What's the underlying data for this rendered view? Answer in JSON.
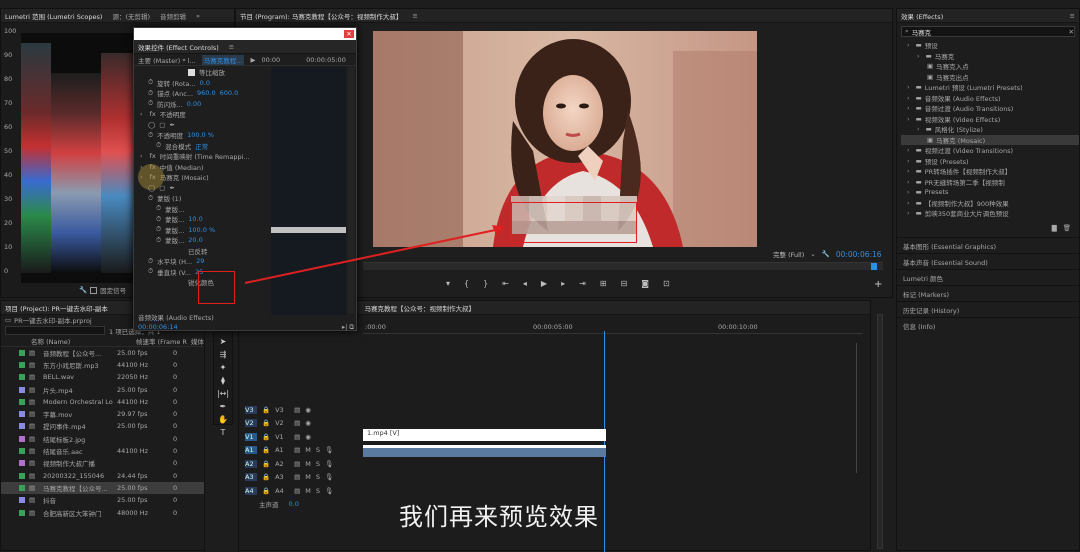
{
  "scopes": {
    "tab_scopes": "Lumetri 范围 (Lumetri Scopes)",
    "tab_source": "源：(无剪辑)",
    "tab_audio": "音频剪辑",
    "ticks": [
      "100",
      "90",
      "80",
      "70",
      "60",
      "50",
      "40",
      "30",
      "20",
      "10",
      "0"
    ],
    "checkbox_label": "固定信号"
  },
  "effect_controls": {
    "title": "效果控件 (Effect Controls)",
    "master": "主要 (Master) * l...",
    "clip": "马赛克教程...",
    "timecode_start": "00:00",
    "timecode_mid": "00:00:05:00",
    "rows": [
      {
        "label": "等比缩放",
        "value": "",
        "v2": "",
        "ind": 54,
        "check": true
      },
      {
        "label": "旋转 (Rota...",
        "value": "0.0",
        "v2": "",
        "ind": 14
      },
      {
        "label": "锚点 (Anc...",
        "value": "960.0",
        "v2": "600.0",
        "ind": 14
      },
      {
        "label": "防闪烁...",
        "value": "0.00",
        "v2": "",
        "ind": 14
      },
      {
        "label": "不透明度",
        "value": "",
        "v2": "",
        "ind": 6,
        "fx": true
      },
      {
        "label": "",
        "value": "",
        "v2": "",
        "ind": 14,
        "shapes": true
      },
      {
        "label": "不透明度",
        "value": "100.0 %",
        "v2": "",
        "ind": 14
      },
      {
        "label": "混合模式",
        "value": "正常",
        "v2": "",
        "ind": 22
      },
      {
        "label": "时间重映射 (Time Remappi...",
        "value": "",
        "v2": "",
        "ind": 6,
        "fx": true
      },
      {
        "label": "中值 (Median)",
        "value": "",
        "v2": "",
        "ind": 6,
        "fx": true
      },
      {
        "label": "马赛克 (Mosaic)",
        "value": "",
        "v2": "",
        "ind": 6,
        "fx": true
      },
      {
        "label": "",
        "value": "",
        "v2": "",
        "ind": 14,
        "shapes": true
      },
      {
        "label": "蒙版 (1)",
        "value": "",
        "v2": "",
        "ind": 14
      },
      {
        "label": "蒙版...",
        "value": "",
        "v2": "",
        "ind": 22
      },
      {
        "label": "蒙版...",
        "value": "10.0",
        "v2": "",
        "ind": 22
      },
      {
        "label": "蒙版...",
        "value": "100.0 %",
        "v2": "",
        "ind": 22
      },
      {
        "label": "蒙版...",
        "value": "20.0",
        "v2": "",
        "ind": 22
      },
      {
        "label": "已反转",
        "value": "",
        "v2": "",
        "ind": 54
      },
      {
        "label": "水平块 (H...",
        "value": "29",
        "v2": "",
        "ind": 14
      },
      {
        "label": "垂直块 (V...",
        "value": "25",
        "v2": "",
        "ind": 14
      },
      {
        "label": "锐化颜色",
        "value": "",
        "v2": "",
        "ind": 54
      }
    ],
    "audio_label": "音频效果 (Audio Effects)",
    "timecode": "00:00:06:14"
  },
  "program": {
    "tab": "节目 (Program): 马赛克教程【公众号：视频制作大叔】",
    "fit": "完整 (Full)",
    "timecode": "00:00:06:16"
  },
  "effects": {
    "title": "效果 (Effects)",
    "search": "马赛克",
    "items": [
      {
        "label": "预设",
        "ind": 6,
        "type": "folder"
      },
      {
        "label": "马赛克",
        "ind": 16,
        "type": "folder"
      },
      {
        "label": "马赛克入点",
        "ind": 26,
        "type": "file"
      },
      {
        "label": "马赛克出点",
        "ind": 26,
        "type": "file"
      },
      {
        "label": "Lumetri 预设 (Lumetri Presets)",
        "ind": 6,
        "type": "folder"
      },
      {
        "label": "音频效果 (Audio Effects)",
        "ind": 6,
        "type": "folder"
      },
      {
        "label": "音频过渡 (Audio Transitions)",
        "ind": 6,
        "type": "folder"
      },
      {
        "label": "视频效果 (Video Effects)",
        "ind": 6,
        "type": "folder"
      },
      {
        "label": "风格化 (Stylize)",
        "ind": 16,
        "type": "folder"
      },
      {
        "label": "马赛克 (Mosaic)",
        "ind": 26,
        "type": "file",
        "sel": true
      },
      {
        "label": "视频过渡 (Video Transitions)",
        "ind": 6,
        "type": "folder"
      },
      {
        "label": "预设 (Presets)",
        "ind": 6,
        "type": "folder"
      },
      {
        "label": "PR转场插件【视频制作大叔】",
        "ind": 6,
        "type": "folder"
      },
      {
        "label": "PR无缝转场第二季【视频制",
        "ind": 6,
        "type": "folder"
      },
      {
        "label": "Presets",
        "ind": 6,
        "type": "folder"
      },
      {
        "label": "【视频制作大叔】900种效果",
        "ind": 6,
        "type": "folder"
      },
      {
        "label": "剪映350套商业大片调色预设",
        "ind": 6,
        "type": "folder"
      }
    ],
    "sections": [
      "基本图形 (Essential Graphics)",
      "基本声音 (Essential Sound)",
      "Lumetri 颜色",
      "标记 (Markers)",
      "历史记录 (History)",
      "信息 (Info)"
    ]
  },
  "project": {
    "title": "项目 (Project): PR一键去水印-副本",
    "file": "PR一键去水印-副本.prproj",
    "items_selected": "1 项已选择，共 1",
    "col_name": "名称 (Name)",
    "col_fps": "帧速率 (Frame R",
    "col_media": "媒体",
    "rows": [
      {
        "name": "音频教程【公众号...",
        "fps": "25.00 fps",
        "m": "0",
        "color": "#3aa05a",
        "icon": "seq"
      },
      {
        "name": "东方小戏尼斯.mp3",
        "fps": "44100 Hz",
        "m": "0",
        "color": "#3aa05a",
        "icon": "aud"
      },
      {
        "name": "BELL.wav",
        "fps": "22050 Hz",
        "m": "0",
        "color": "#3aa05a",
        "icon": "aud"
      },
      {
        "name": "片头.mp4",
        "fps": "25.00 fps",
        "m": "0",
        "color": "#8a8ae0",
        "icon": "vid"
      },
      {
        "name": "Modern Orchestral Log",
        "fps": "44100 Hz",
        "m": "0",
        "color": "#3aa05a",
        "icon": "aud"
      },
      {
        "name": "字幕.mov",
        "fps": "29.97 fps",
        "m": "0",
        "color": "#8a8ae0",
        "icon": "vid"
      },
      {
        "name": "提问事件.mp4",
        "fps": "25.00 fps",
        "m": "0",
        "color": "#8a8ae0",
        "icon": "vid"
      },
      {
        "name": "结尾标板2.jpg",
        "fps": "",
        "m": "0",
        "color": "#b070d0",
        "icon": "img"
      },
      {
        "name": "结尾音乐.aac",
        "fps": "44100 Hz",
        "m": "0",
        "color": "#3aa05a",
        "icon": "aud"
      },
      {
        "name": "视频制作大叔广播",
        "fps": "",
        "m": "0",
        "color": "#b070d0",
        "icon": "img"
      },
      {
        "name": "20200322_155046",
        "fps": "24.44 fps",
        "m": "0",
        "color": "#3aa05a",
        "icon": "seq"
      },
      {
        "name": "马赛克教程【公众号...",
        "fps": "25.00 fps",
        "m": "0",
        "color": "#3aa05a",
        "icon": "seq",
        "sel": true
      },
      {
        "name": "抖音",
        "fps": "25.00 fps",
        "m": "0",
        "color": "#8a8ae0",
        "icon": "vid"
      },
      {
        "name": "合肥高新区大笨钟门",
        "fps": "48000 Hz",
        "m": "0",
        "color": "#3aa05a",
        "icon": "aud"
      }
    ]
  },
  "timeline": {
    "title": "马赛克教程【公众号：视频制作大叔】",
    "t0": ":00:00",
    "t1": "00:00:05:00",
    "t2": "00:00:10:00",
    "tracks": [
      {
        "name": "V3",
        "kind": "v"
      },
      {
        "name": "V2",
        "kind": "v"
      },
      {
        "name": "V1",
        "kind": "v"
      },
      {
        "name": "A1",
        "kind": "a"
      },
      {
        "name": "A2",
        "kind": "a"
      },
      {
        "name": "A3",
        "kind": "a"
      },
      {
        "name": "A4",
        "kind": "a"
      }
    ],
    "clip_label": "1.mp4 [V]",
    "master": "主声道",
    "master_val": "0.0",
    "subtitle": "我们再来预览效果"
  }
}
